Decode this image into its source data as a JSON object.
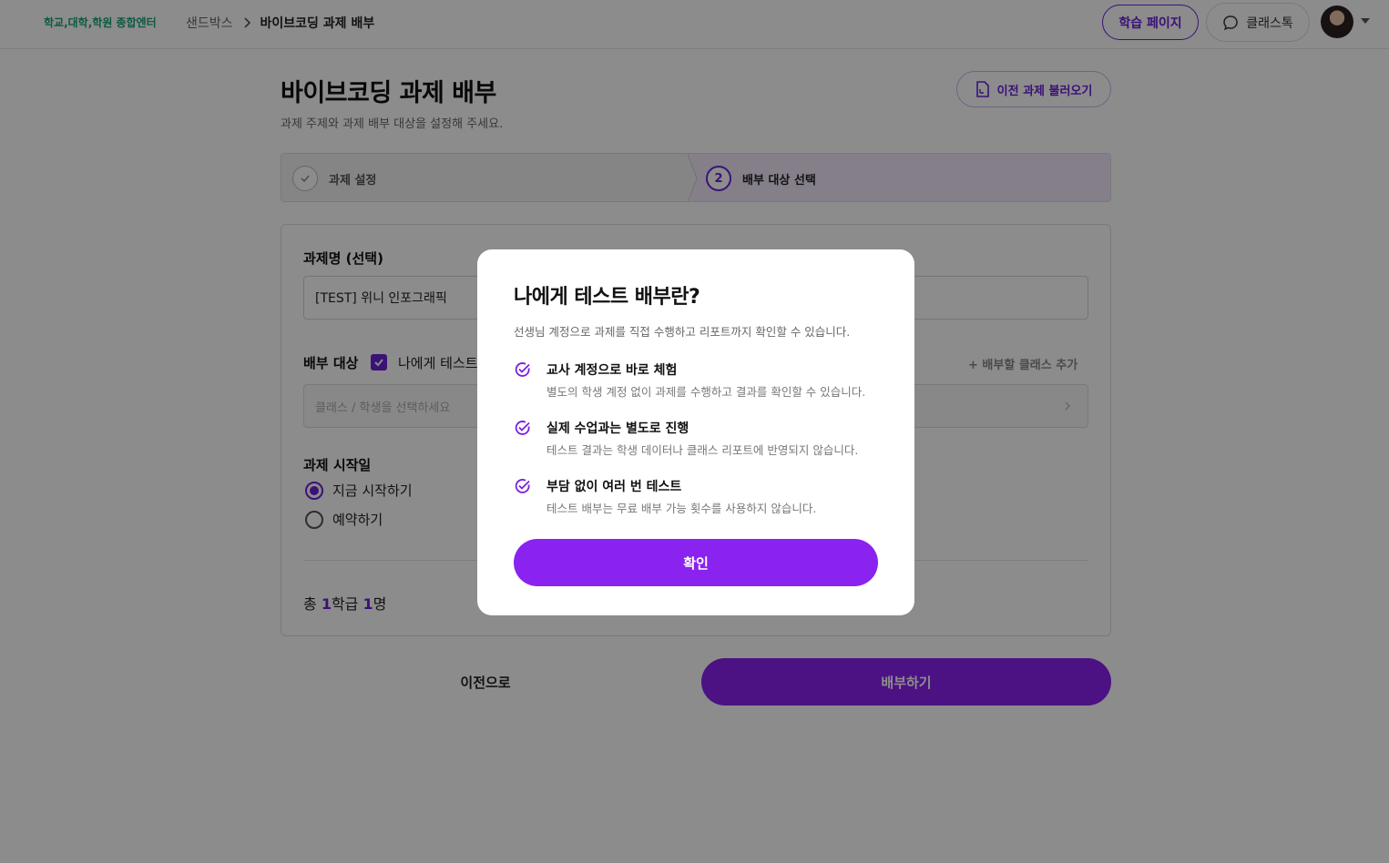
{
  "header": {
    "brand": "학교,대학,학원 종합엔터",
    "breadcrumb": {
      "parent": "샌드박스",
      "current": "바이브코딩 과제 배부"
    },
    "study_button": "학습 페이지",
    "talk_button": "클래스톡",
    "colors": {
      "accent": "#6b21d8",
      "brand": "#1aa37a"
    }
  },
  "page": {
    "title": "바이브코딩 과제 배부",
    "subtitle": "과제 주제와 과제 배부 대상을 설정해 주세요.",
    "prev_assign_button": "이전 과제 불러오기"
  },
  "stepper": {
    "steps": [
      {
        "number": "",
        "label": "과제 설정",
        "state": "done"
      },
      {
        "number": "2",
        "label": "배부 대상 선택",
        "state": "active"
      }
    ]
  },
  "form": {
    "name_label": "과제명 (선택)",
    "name_value": "[TEST] 위니 인포그래픽",
    "target_label": "배부 대상",
    "test_checkbox_label": "나에게 테스트 배부",
    "add_class_label": "+ 배부할 클래스 추가",
    "target_placeholder": "클래스 / 학생을 선택하세요",
    "start_label": "과제 시작일",
    "start_options": [
      {
        "label": "지금 시작하기",
        "selected": true
      },
      {
        "label": "예약하기",
        "selected": false
      }
    ],
    "total": {
      "prefix": "총 ",
      "classes": "1",
      "classes_unit": "학급 ",
      "students": "1",
      "students_unit": "명"
    }
  },
  "footer": {
    "back_button": "이전으로",
    "assign_button": "배부하기"
  },
  "modal": {
    "title": "나에게 테스트 배부란?",
    "description": "선생님 계정으로 과제를 직접 수행하고 리포트까지 확인할 수 있습니다.",
    "items": [
      {
        "title": "교사 계정으로 바로 체험",
        "desc": "별도의 학생 계정 없이 과제를 수행하고 결과를 확인할 수 있습니다."
      },
      {
        "title": "실제 수업과는 별도로 진행",
        "desc": "테스트 결과는 학생 데이터나 클래스 리포트에 반영되지 않습니다."
      },
      {
        "title": "부담 없이 여러 번 테스트",
        "desc": "테스트 배부는 무료 배부 가능 횟수를 사용하지 않습니다."
      }
    ],
    "confirm_button": "확인"
  }
}
